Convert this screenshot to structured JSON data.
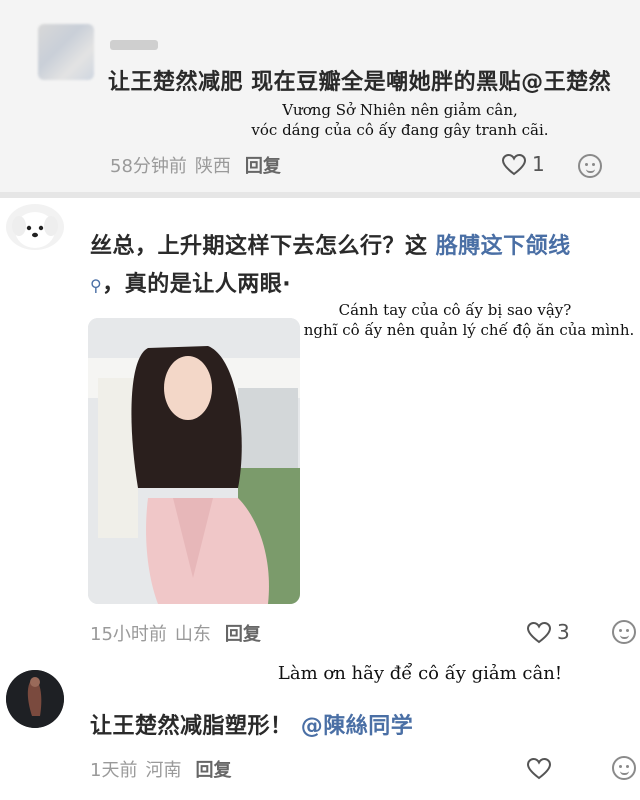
{
  "comments": [
    {
      "text": "让王楚然减肥 现在豆瓣全是嘲她胖的黑贴",
      "mention": "@王楚然",
      "time": "58分钟前",
      "location": "陕西",
      "reply_label": "回复",
      "likes": "1",
      "translation": [
        "Vương Sở Nhiên nên giảm cân,",
        "vóc dáng của cô ấy đang gây tranh cãi."
      ]
    },
    {
      "text_prefix": "丝总，上升期这样下去怎么行？这 ",
      "link_text": "胳膊这下颌线",
      "text_suffix": "，真的是让人两眼·",
      "time": "15小时前",
      "location": "山东",
      "reply_label": "回复",
      "likes": "3",
      "translation": [
        "Cánh tay của cô ấy bị sao vậy?",
        "Tôi nghĩ cô ấy nên quản lý chế độ ăn của mình."
      ]
    },
    {
      "text": "让王楚然减脂塑形！",
      "mention": "@陳絲同学",
      "time": "1天前",
      "location": "河南",
      "reply_label": "回复",
      "translation": [
        "Làm ơn hãy để cô ấy giảm cân!"
      ]
    }
  ],
  "icons": {
    "like": "heart-outline-icon",
    "emoji": "smiley-face-icon",
    "search_hint": "search-icon"
  },
  "colors": {
    "link": "#4a6fa5",
    "meta": "#9a9a9a"
  }
}
